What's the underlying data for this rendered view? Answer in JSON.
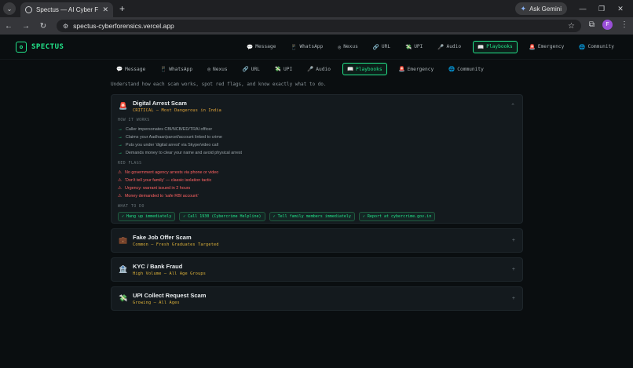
{
  "browser": {
    "tab_title": "Spectus — AI Cyber Forensics",
    "url": "spectus-cyberforensics.vercel.app",
    "gemini_label": "Ask Gemini",
    "profile_initial": "F"
  },
  "site": {
    "logo": "SPECTUS",
    "nav": [
      {
        "icon": "💬",
        "label": "Message"
      },
      {
        "icon": "📱",
        "label": "WhatsApp"
      },
      {
        "icon": "◎",
        "label": "Nexus"
      },
      {
        "icon": "🔗",
        "label": "URL"
      },
      {
        "icon": "💸",
        "label": "UPI"
      },
      {
        "icon": "🎤",
        "label": "Audio"
      },
      {
        "icon": "📖",
        "label": "Playbooks"
      },
      {
        "icon": "🚨",
        "label": "Emergency"
      },
      {
        "icon": "🌐",
        "label": "Community"
      }
    ],
    "active_nav": "Playbooks"
  },
  "intro": "Understand how each scam works, spot red flags, and know exactly what to do.",
  "playbooks": [
    {
      "icon": "🚨",
      "title": "Digital Arrest Scam",
      "subtitle": "CRITICAL — Most Dangerous in India",
      "expanded": true,
      "how_label": "HOW IT WORKS",
      "steps": [
        "Caller impersonates CBI/NCB/ED/TRAI officer",
        "Claims your Aadhaar/parcel/account linked to crime",
        "Puts you under 'digital arrest' via Skype/video call",
        "Demands money to clear your name and avoid physical arrest"
      ],
      "flags_label": "RED FLAGS",
      "flags": [
        "No government agency arrests via phone or video",
        "'Don't tell your family' — classic isolation tactic",
        "Urgency: warrant issued in 2 hours",
        "Money demanded to 'safe RBI account'"
      ],
      "actions_label": "WHAT TO DO",
      "actions": [
        "✓ Hang up immediately",
        "✓ Call 1930 (Cybercrime Helpline)",
        "✓ Tell family members immediately",
        "✓ Report at cybercrime.gov.in"
      ]
    },
    {
      "icon": "💼",
      "title": "Fake Job Offer Scam",
      "subtitle": "Common — Fresh Graduates Targeted"
    },
    {
      "icon": "🏦",
      "title": "KYC / Bank Fraud",
      "subtitle": "High Volume — All Age Groups"
    },
    {
      "icon": "💸",
      "title": "UPI Collect Request Scam",
      "subtitle": "Growing — All Ages"
    }
  ]
}
